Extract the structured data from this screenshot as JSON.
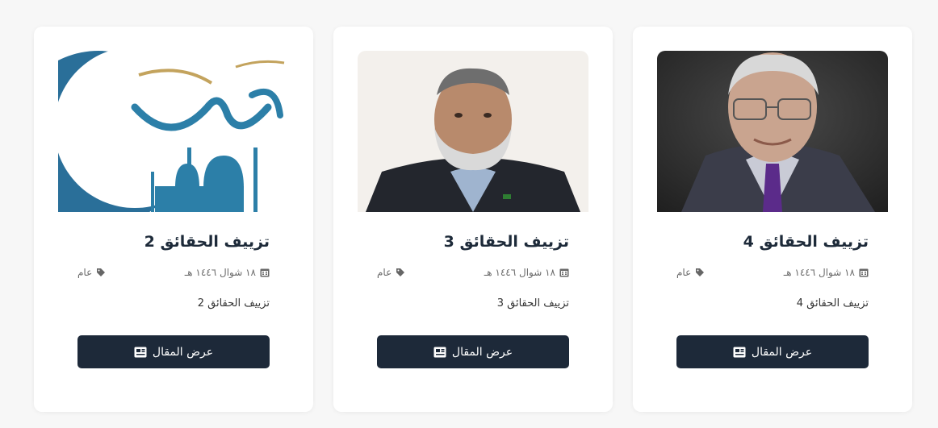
{
  "cards": [
    {
      "title": "تزييف الحقائق 4",
      "date": "١٨ شوال ١٤٤٦ هـ",
      "category": "عام",
      "excerpt": "تزييف الحقائق 4",
      "button_label": "عرض المقال",
      "image": "portrait-elderly-man"
    },
    {
      "title": "تزييف الحقائق 3",
      "date": "١٨ شوال ١٤٤٦ هـ",
      "category": "عام",
      "excerpt": "تزييف الحقائق 3",
      "button_label": "عرض المقال",
      "image": "portrait-man-beard"
    },
    {
      "title": "تزييف الحقائق 2",
      "date": "١٨ شوال ١٤٤٦ هـ",
      "category": "عام",
      "excerpt": "تزييف الحقائق 2",
      "button_label": "عرض المقال",
      "image": "calligraphy-mosque"
    }
  ],
  "icons": {
    "calendar": "calendar-icon",
    "tag": "tag-icon",
    "article": "newspaper-icon"
  },
  "colors": {
    "button_bg": "#1d2939",
    "title": "#1d2a39",
    "page_bg": "#f7f7f7"
  }
}
